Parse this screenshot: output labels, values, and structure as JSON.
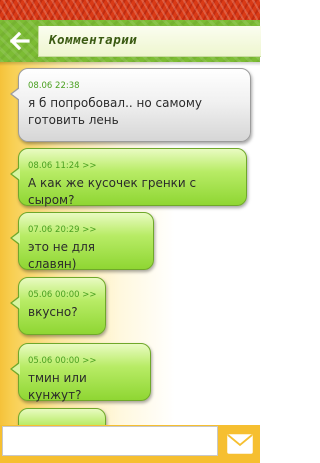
{
  "header": {
    "title": "Комментарии"
  },
  "comments": [
    {
      "meta": "08.06 22:38",
      "text": "я б попробовал.. но самому готовить лень",
      "style": "grey"
    },
    {
      "meta": "08.06 11:24 >>",
      "text": "А как же кусочек гренки с сыром?",
      "style": "green"
    },
    {
      "meta": "07.06 20:29 >>",
      "text": "это не для славян)",
      "style": "green"
    },
    {
      "meta": "05.06 00:00 >>",
      "text": "вкусно?",
      "style": "green"
    },
    {
      "meta": "05.06 00:00 >>",
      "text": "тмин или кунжут?",
      "style": "green"
    }
  ],
  "composer": {
    "value": "",
    "placeholder": ""
  },
  "icons": {
    "back": "arrow-left-icon",
    "send": "envelope-icon"
  },
  "colors": {
    "header_green": "#7cbc34",
    "top_strip_red": "#d93a16",
    "sidebar_yellow": "#f5c23a",
    "meta_green": "#4aa020"
  }
}
